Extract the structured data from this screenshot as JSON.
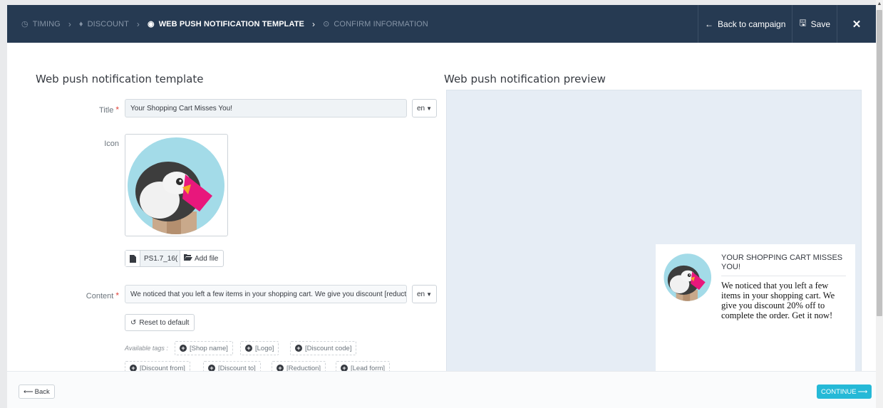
{
  "wizard": {
    "steps": [
      {
        "label": "TIMING",
        "icon": "clock-icon",
        "state": "done"
      },
      {
        "label": "DISCOUNT",
        "icon": "tag-icon",
        "state": "done"
      },
      {
        "label": "WEB PUSH NOTIFICATION TEMPLATE",
        "icon": "eye-icon",
        "state": "active"
      },
      {
        "label": "CONFIRM INFORMATION",
        "icon": "check-circle-icon",
        "state": "pending"
      }
    ],
    "back_to_campaign": "Back to campaign",
    "save": "Save"
  },
  "form": {
    "heading": "Web push notification template",
    "title_label": "Title",
    "title_value": "Your Shopping Cart Misses You!",
    "lang": "en",
    "icon_label": "Icon",
    "file_name": "PS1.7_16(",
    "add_file": "Add file",
    "content_label": "Content",
    "content_value": "We noticed that you left a few items in your shopping cart. We give you discount [reduction] off to complete the order. Get it now!",
    "reset_label": "Reset to default",
    "available_tags_label": "Available tags :",
    "tags": [
      "[Shop name]",
      "[Logo]",
      "[Discount code]",
      "[Discount from]",
      "[Discount to]",
      "[Reduction]",
      "[Lead form]"
    ]
  },
  "preview": {
    "heading": "Web push notification preview",
    "title": "YOUR SHOPPING CART MISSES YOU!",
    "body": "We noticed that you left a few items in your shopping cart. We give you discount 20% off to complete the order. Get it now!"
  },
  "footer": {
    "back": "Back",
    "continue": "CONTINUE"
  },
  "colors": {
    "topbar": "#263a52",
    "accent": "#25b9d7",
    "required": "#e0433a"
  }
}
